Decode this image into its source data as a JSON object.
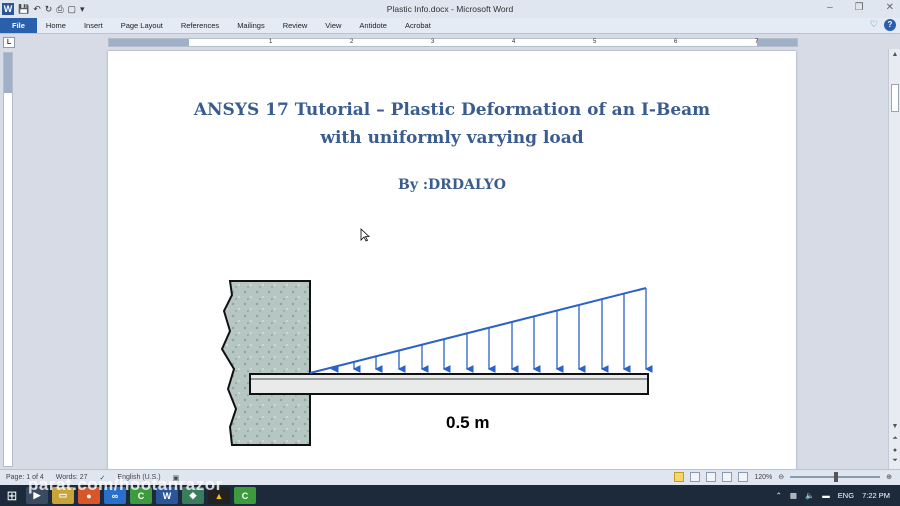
{
  "window": {
    "title": "Plastic Info.docx - Microsoft Word"
  },
  "ribbon": {
    "tabs": [
      "File",
      "Home",
      "Insert",
      "Page Layout",
      "References",
      "Mailings",
      "Review",
      "View",
      "Antidote",
      "Acrobat"
    ]
  },
  "ruler": {
    "ticks": [
      "1",
      "2",
      "3",
      "4",
      "5",
      "6",
      "7"
    ]
  },
  "document": {
    "title_line1": "ANSYS 17 Tutorial – Plastic Deformation of an I-Beam",
    "title_line2": "with uniformly varying load",
    "author": "By :DRDALYO",
    "figure_label": "0.5 m"
  },
  "status": {
    "page": "Page: 1 of 4",
    "words": "Words: 27",
    "language": "English (U.S.)",
    "zoom": "120%"
  },
  "taskbar": {
    "watermark": "parat.com/hootanrazor",
    "language": "ENG",
    "time": "7:22 PM"
  }
}
